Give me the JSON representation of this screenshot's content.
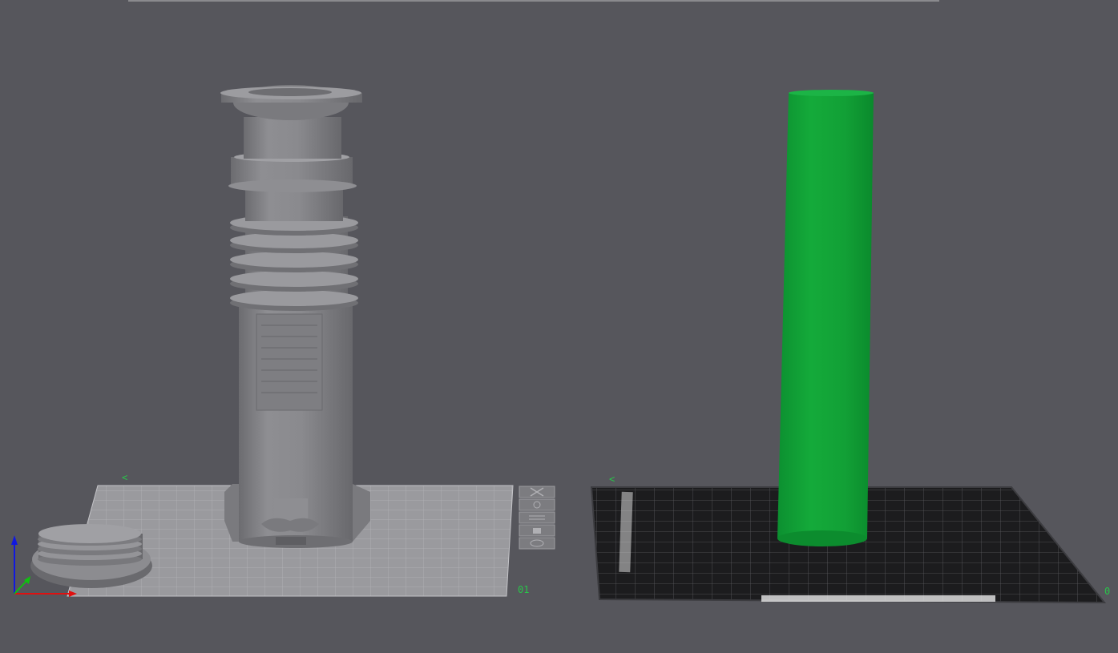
{
  "viewport": {
    "background": "#56565c",
    "bed_left": {
      "label_top": "<",
      "label_bottom": "01"
    },
    "bed_right": {
      "label_top": "<",
      "label_bottom": "0"
    }
  },
  "colors": {
    "model_gray": "#8a8a8e",
    "model_gray_dark": "#6e6e72",
    "model_gray_light": "#a0a0a4",
    "selected_green": "#12a537",
    "axis_x": "#e01010",
    "axis_y": "#10c010",
    "axis_z": "#1018e0"
  },
  "objects": [
    {
      "name": "saber-hilt",
      "selected": false
    },
    {
      "name": "hilt-cap",
      "selected": false
    },
    {
      "name": "blade-tube",
      "selected": true
    }
  ],
  "side_toolbar": [
    "close-icon",
    "scale-icon",
    "layers-icon",
    "lock-icon",
    "view-icon"
  ]
}
